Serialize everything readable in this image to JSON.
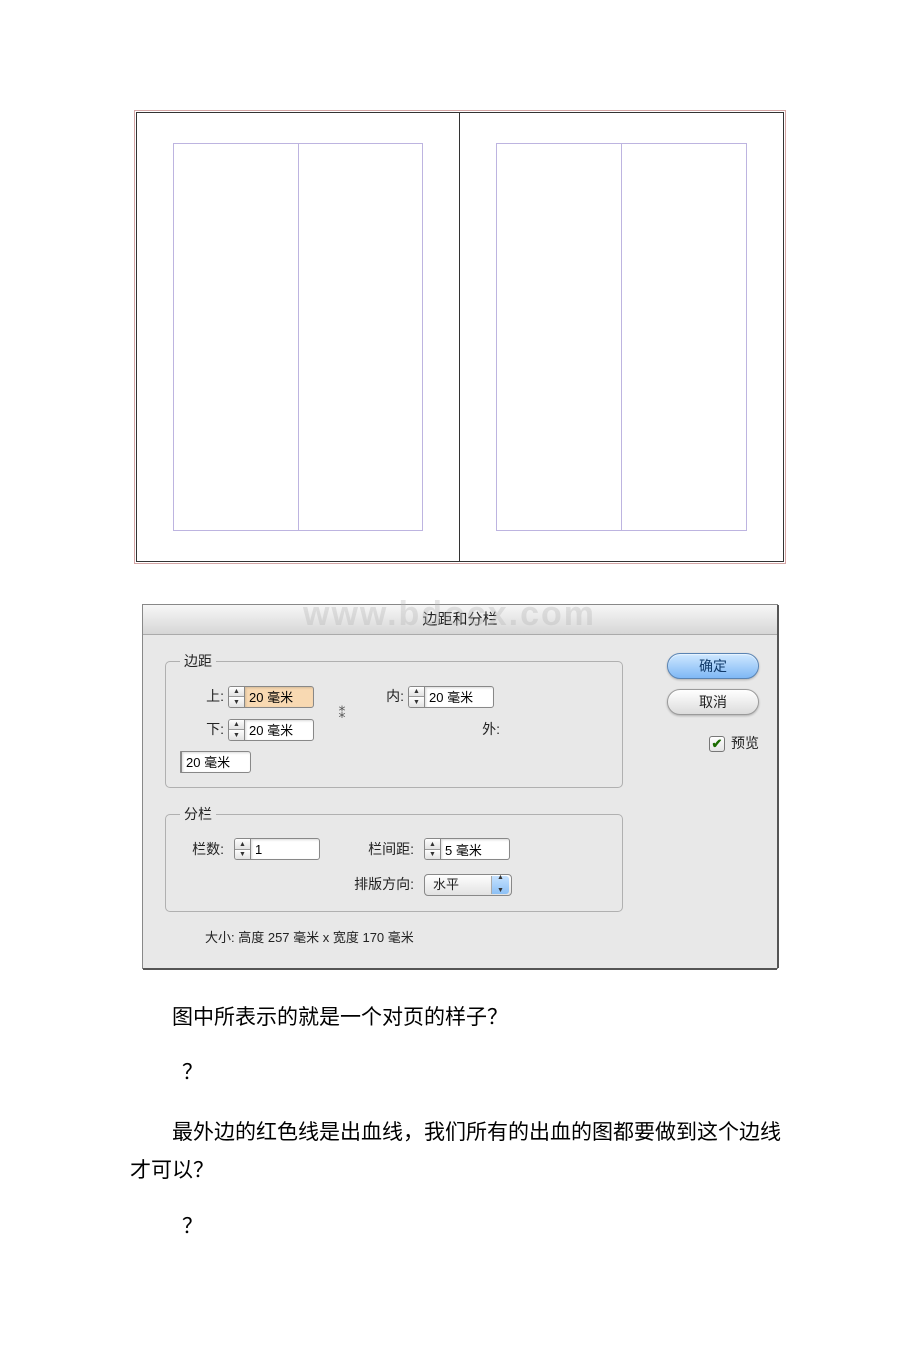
{
  "watermark": "www.bdocx.com",
  "dialog": {
    "title": "边距和分栏",
    "margins_legend": "边距",
    "columns_legend": "分栏",
    "labels": {
      "top": "上:",
      "bottom": "下:",
      "inside": "内:",
      "outside": "外:",
      "count": "栏数:",
      "gutter": "栏间距:",
      "direction": "排版方向:"
    },
    "values": {
      "top": "20 毫米",
      "bottom": "20 毫米",
      "inside": "20 毫米",
      "outside": "20 毫米",
      "count": "1",
      "gutter": "5 毫米",
      "direction": "水平"
    },
    "size_text": "大小: 高度 257 毫米 x 宽度 170 毫米",
    "ok": "确定",
    "cancel": "取消",
    "preview": "预览",
    "link_glyph": "⁑"
  },
  "paragraphs": {
    "p1": "图中所表示的就是一个对页的样子？",
    "q1": "？",
    "p2": "最外边的红色线是出血线，我们所有的出血的图都要做到这个边线才可以？",
    "q2": "？"
  }
}
